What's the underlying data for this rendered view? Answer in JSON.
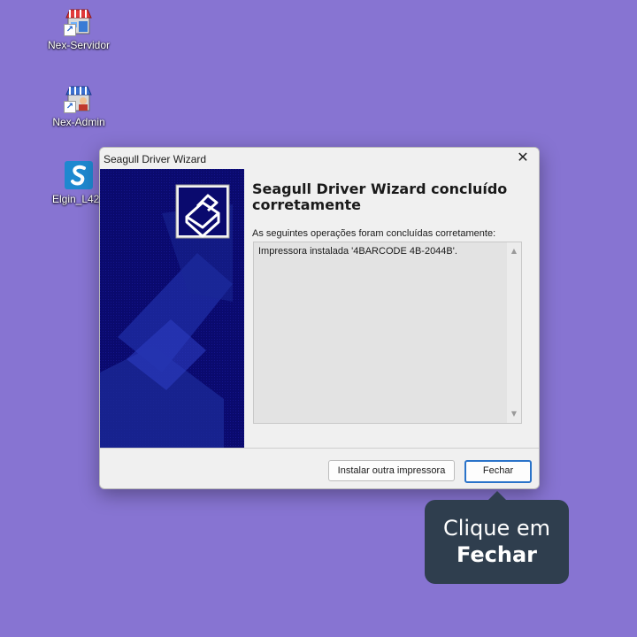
{
  "desktop": {
    "icons": [
      {
        "label": "Nex-Servidor",
        "icon": "store-server-icon"
      },
      {
        "label": "Nex-Admin",
        "icon": "store-admin-icon"
      },
      {
        "label": "Elgin_L42_",
        "icon": "seagull-s-icon"
      }
    ]
  },
  "dialog": {
    "title": "Seagull Driver Wizard",
    "heading": "Seagull Driver Wizard concluído corretamente",
    "subtitle": "As seguintes operações foram concluídas corretamente:",
    "log_lines": [
      "Impressora instalada '4BARCODE 4B-2044B'."
    ],
    "buttons": {
      "install_other": "Instalar outra impressora",
      "close": "Fechar"
    },
    "banner_color": "#0a0a6e"
  },
  "tooltip": {
    "line1": "Clique em",
    "line2": "Fechar"
  },
  "colors": {
    "desktop_bg": "#8774d2",
    "tooltip_bg": "#2f3e4e",
    "focus_border": "#2a73c9"
  }
}
